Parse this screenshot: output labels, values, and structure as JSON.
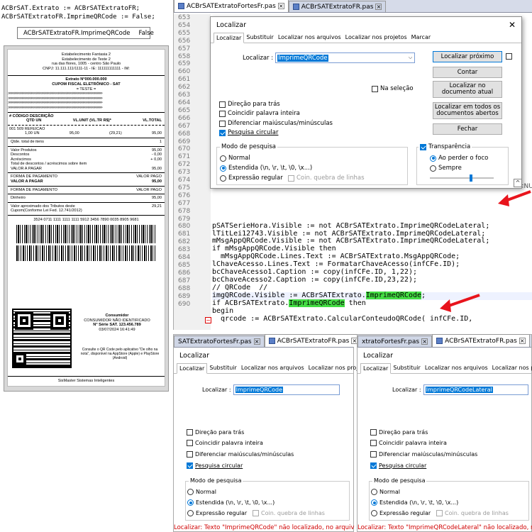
{
  "top_code": {
    "line1": "ACBrSAT.Extrato := ACBrSATExtratoFR;",
    "line2": "ACBrSATExtratoFR.ImprimeQRCode := False;"
  },
  "property": {
    "name": "ACBrSATExtratoFR.ImprimeQRCode",
    "value": "False"
  },
  "receipt": {
    "company": "Estabelecimento Fantasia 2",
    "company2": "Estabelecimento de Teste 2",
    "address": "rua das flores, 1005 - centro São Paulo",
    "cnpj": "CNPJ: 11.111.111/1111-11 - IE: 111111111111 - IM:",
    "extrato": "Extrato N°000.000.000",
    "cupom": "CUPOM FISCAL ELETRÔNICO - SAT",
    "teste": "= TESTE =",
    "arrows": ">>>>>>>>>>>>>>>>>>>>>>>>>>>>>>>>>>>>>>>>>>>>>>>>>>>>>>>>>>>>",
    "item_header1": "#   CÓDIGO   DESCRIÇÃO",
    "item_header2_left": "QTD UN",
    "item_header2_mid": "VL.UNIT  (VL.TR R$)*",
    "item_header2_right": "VL.TOTAL",
    "item_line1": "001  509        REFEICAO",
    "item_qty": "1,00 UN",
    "item_unit": "95,00",
    "item_tr": "(29,21)",
    "item_total": "95,00",
    "qtd_label": "Qtde. total de itens",
    "qtd_value": "1",
    "rows": [
      {
        "label": "Valor Produtos",
        "value": "95,00"
      },
      {
        "label": "Descontos",
        "value": "- 0,00"
      },
      {
        "label": "Acréscimos",
        "value": "+ 0,00"
      },
      {
        "label": "Total de descontos / acréscimos sobre item",
        "value": ""
      },
      {
        "label": "VALOR A PAGAR",
        "value": "95,00"
      }
    ],
    "pag1_label": "FORMA DE PAGAMENTO",
    "pag1_value": "VALOR PAGO",
    "pag1_total_label": "VALOR A PAGAR",
    "pag1_total_value": "95,00",
    "pag2_label": "FORMA DE PAGAMENTO",
    "pag2_value": "VALOR PAGO",
    "dinheiro_label": "Dinheiro",
    "dinheiro_value": "95,00",
    "tributos": "Valor aproximado dos Tributos deste",
    "tributos_value": "29,21",
    "tributos2": "Cupom(Conforme Lei Fed. 12.741/2012)",
    "chave": "3524 0711 1111 1111 1111 5912 3456 7890 0035 8905 9681",
    "consumidor": "Consumidor",
    "consumidor2": "CONSUMIDOR NÃO IDENTIFICADO",
    "serie": "N° Série SAT. 123.456.789",
    "datetime": "03/07/2024 16:41:49",
    "consulte": "Consulte o QR Code pelo aplicativo \"De olho na nota\", disponível na AppStore (Apple) e PlayStore (Android)",
    "footer": "SisMaster Sistemas Inteligentes"
  },
  "ide": {
    "tab1": "ACBrSATExtratoFortesFr.pas",
    "tab2": "ACBrSATExtratoFR.pas",
    "line_numbers": [
      "653",
      "654",
      "655",
      "656",
      "657",
      "658",
      "659",
      "660",
      "661",
      "662",
      "663",
      "664",
      "665",
      "666",
      "667",
      "668",
      "669",
      "670",
      "671",
      "672",
      "673",
      "674",
      "675",
      "676",
      "677",
      "678",
      "679",
      "680",
      "681",
      "682",
      "683",
      "684",
      "685",
      "686",
      "687",
      "688",
      "689",
      "690"
    ],
    "code": [
      "pSATSerieHora.Visible := not ACBrSATExtrato.ImprimeQRCodeLateral;",
      "lTitLei12743.Visible := not ACBrSATExtrato.ImprimeQRCodeLateral;",
      "mMsgAppQRCode.Visible := not ACBrSATExtrato.ImprimeQRCodeLateral;",
      "if mMsgAppQRCode.Visible then",
      "  mMsgAppQRCode.Lines.Text := ACBrSATExtrato.MsgAppQRCode;",
      "",
      "lChaveAcesso.Lines.Text := FormatarChaveAcesso(infCFe.ID);",
      "bcChaveAcesso1.Caption := copy(infCFe.ID, 1,22);",
      "bcChaveAcesso2.Caption := copy(infCFe.ID,23,22);",
      "",
      "// QRCode  //",
      "imgQRCode.Visible := ACBrSATExtrato.ImprimeQRCode;",
      "if ACBrSATExtrato.ImprimeQRCode then",
      "begin",
      "  qrcode := ACBrSATExtrato.CalcularConteudoQRCode( infCFe.ID,"
    ],
    "side_text": "<NU"
  },
  "dialog_main": {
    "title": "Localizar",
    "tabs": [
      "Localizar",
      "Substituir",
      "Localizar nos arquivos",
      "Localizar nos projetos",
      "Marcar"
    ],
    "find_label": "Localizar :",
    "find_value": "ImprimeQRCode",
    "btn_next": "Localizar próximo",
    "btn_count": "Contar",
    "btn_doc": "Localizar no documento atual",
    "btn_all": "Localizar em todos os documentos abertos",
    "btn_close": "Fechar",
    "na_selecao": "Na seleção",
    "opt_backward": "Direção para trás",
    "opt_whole": "Coincidir palavra inteira",
    "opt_case": "Diferenciar maiúsculas/minúsculas",
    "opt_wrap": "Pesquisa circular",
    "mode_title": "Modo de pesquisa",
    "mode_normal": "Normal",
    "mode_extended": "Estendida (\\n, \\r, \\t, \\0, \\x...)",
    "mode_regex": "Expressão regular",
    "mode_newline": "Coin. quebra de linhas",
    "transparency": "Transparência",
    "on_lose_focus": "Ao perder o foco",
    "always": "Sempre"
  },
  "dialog_left": {
    "tab1": "SATExtratoFortesFr.pas",
    "tab2": "ACBrSATExtratoFR.pas",
    "title": "Localizar",
    "tabs": [
      "Localizar",
      "Substituir",
      "Localizar nos arquivos",
      "Localizar nos proj"
    ],
    "find_label": "Localizar :",
    "find_value": "ImprimeQRCode",
    "status": "Localizar: Texto \"ImprimeQRCode\" não localizado, no arquiv"
  },
  "dialog_right": {
    "tab1": "xtratoFortesFr.pas",
    "tab2": "ACBrSATExtratoFR.pas",
    "title": "Localizar",
    "tabs": [
      "Localizar",
      "Substituir",
      "Localizar nos arquivos",
      "Localizar nos p"
    ],
    "find_label": "Localizar :",
    "find_value": "ImprimeQRCodeLateral",
    "status": "Localizar: Texto \"ImprimeQRCodeLateral\" não localizado, r"
  },
  "colors": {
    "accent": "#0078d7",
    "arrow": "#e8141c",
    "highlight": "#44dd44",
    "status_error": "#d00000"
  }
}
